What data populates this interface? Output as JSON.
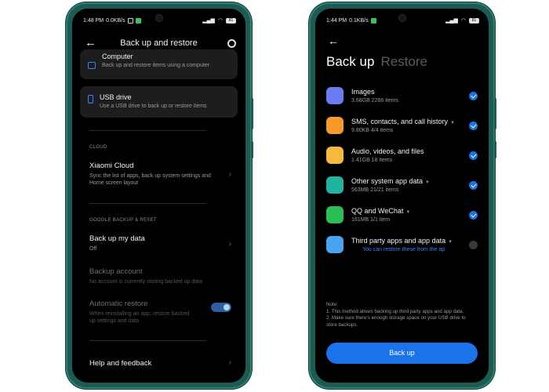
{
  "left": {
    "status": {
      "time": "1:48 PM",
      "speed": "0.0KB/s",
      "battery": "81"
    },
    "title": "Back up and restore",
    "computer": {
      "title": "Computer",
      "subtitle": "Back up and restore items using a computer"
    },
    "usb": {
      "title": "USB drive",
      "subtitle": "Use a USB drive to back up or restore items"
    },
    "cloud_label": "CLOUD",
    "xiaomi_cloud": {
      "title": "Xiaomi Cloud",
      "subtitle": "Sync the list of apps, back up system settings and Home screen layout"
    },
    "google_label": "GOOGLE BACKUP & RESET",
    "backup_my_data": {
      "title": "Back up my data",
      "subtitle": "Off"
    },
    "backup_account": {
      "title": "Backup account",
      "subtitle": "No account is currently storing backed up data"
    },
    "auto_restore": {
      "title": "Automatic restore",
      "subtitle": "When reinstalling an app, restore backed up settings and data",
      "enabled": true
    },
    "help": {
      "title": "Help and feedback"
    },
    "accent_color": "#3b82f6"
  },
  "right": {
    "status": {
      "time": "1:44 PM",
      "speed": "0.1KB/s",
      "battery": "81"
    },
    "tabs": [
      {
        "label": "Back up",
        "active": true
      },
      {
        "label": "Restore",
        "active": false
      }
    ],
    "items": [
      {
        "title": "Images",
        "subtitle": "3.68GB  2266 items",
        "has_caret": false,
        "checked": true,
        "icon": "images-icon",
        "icon_color": "#6b7cf0"
      },
      {
        "title": "SMS, contacts, and call history",
        "subtitle": "9.80KB  4/4 items",
        "has_caret": true,
        "checked": true,
        "icon": "message-icon",
        "icon_color": "#f59a2b"
      },
      {
        "title": "Audio, videos, and files",
        "subtitle": "1.41GB  18 items",
        "has_caret": false,
        "checked": true,
        "icon": "folder-icon",
        "icon_color": "#f5b93b"
      },
      {
        "title": "Other system app data",
        "subtitle": "563MB  21/21 items",
        "has_caret": true,
        "checked": true,
        "icon": "apps-icon",
        "icon_color": "#22b3a0"
      },
      {
        "title": "QQ and WeChat",
        "subtitle": "161MB  1/1 item",
        "has_caret": true,
        "checked": true,
        "icon": "wechat-icon",
        "icon_color": "#2bbf55"
      },
      {
        "title": "Third party apps and app data",
        "subtitle": "You can restore these from the ap",
        "has_caret": true,
        "checked": false,
        "icon": "file-icon",
        "icon_color": "#4aa3f0"
      }
    ],
    "note": "Note:\n1. This method allows backing up third party apps and app data.\n2. Make sure there's enough storage space on your USB drive to store backups.",
    "note_lines": [
      "Note:",
      "1. This method allows backing up third party apps and app data.",
      "2. Make sure there's enough storage space on your USB drive to store backups."
    ],
    "backup_button": "Back up",
    "accent_color": "#1a73e8"
  }
}
